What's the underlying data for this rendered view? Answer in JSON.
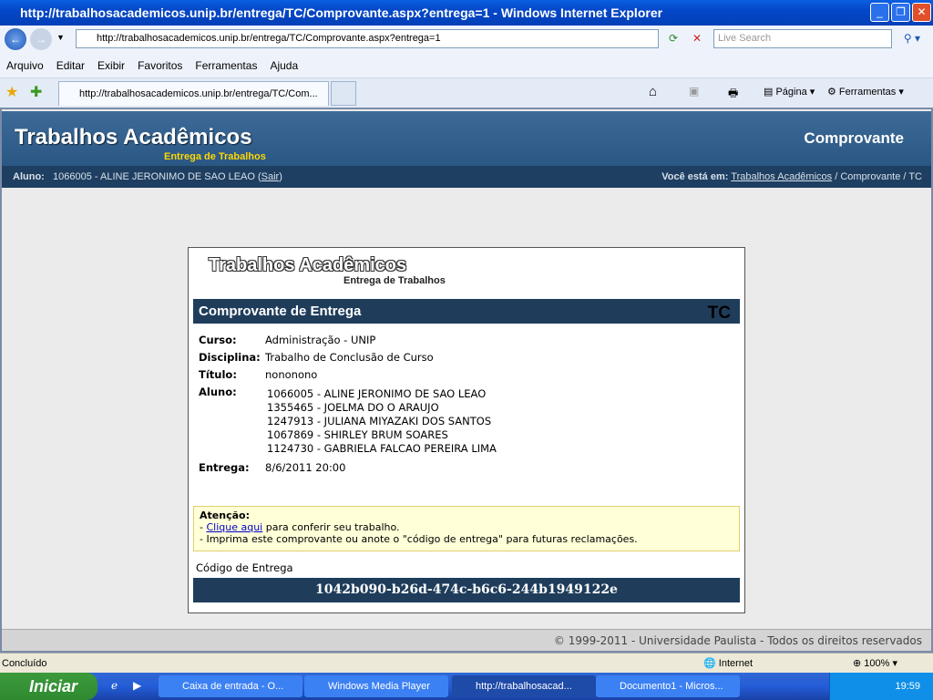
{
  "window": {
    "title": "http://trabalhosacademicos.unip.br/entrega/TC/Comprovante.aspx?entrega=1 - Windows Internet Explorer"
  },
  "browser": {
    "url": "http://trabalhosacademicos.unip.br/entrega/TC/Comprovante.aspx?entrega=1",
    "search_placeholder": "Live Search",
    "menu": [
      "Arquivo",
      "Editar",
      "Exibir",
      "Favoritos",
      "Ferramentas",
      "Ajuda"
    ],
    "tab": "http://trabalhosacademicos.unip.br/entrega/TC/Com...",
    "pagina": "Página",
    "ferramentas": "Ferramentas"
  },
  "header": {
    "title": "Trabalhos Acadêmicos",
    "subtitle": "Entrega de Trabalhos",
    "right": "Comprovante"
  },
  "subbar": {
    "aluno_label": "Aluno:",
    "aluno_value": "1066005 - ALINE JERONIMO DE SAO LEAO (",
    "sair": "Sair",
    "close_paren": ")",
    "location_label": "Você está em:",
    "crumb_link": "Trabalhos Acadêmicos",
    "crumb_rest": " / Comprovante / TC"
  },
  "receipt": {
    "logo_title": "Trabalhos Acadêmicos",
    "logo_sub": "Entrega de Trabalhos",
    "heading": "Comprovante de Entrega",
    "badge": "TC",
    "fields": {
      "curso_label": "Curso:",
      "curso": "Administração - UNIP",
      "disciplina_label": "Disciplina:",
      "disciplina": "Trabalho de Conclusão de Curso",
      "titulo_label": "Título:",
      "titulo": "nononono",
      "aluno_label": "Aluno:",
      "entrega_label": "Entrega:",
      "entrega": "8/6/2011 20:00"
    },
    "alunos": [
      "1066005 - ALINE JERONIMO DE SAO LEAO",
      "1355465 - JOELMA DO O ARAUJO",
      "1247913 - JULIANA MIYAZAKI DOS SANTOS",
      "1067869 - SHIRLEY BRUM SOARES",
      "1124730 - GABRIELA FALCAO PEREIRA LIMA"
    ],
    "attention": {
      "title": "Atenção:",
      "line1_prefix": "- ",
      "line1_link": "Clique aqui",
      "line1_rest": " para conferir seu trabalho.",
      "line2": "- Imprima este comprovante ou anote o \"código de entrega\" para futuras reclamações."
    },
    "code_label": "Código de Entrega",
    "code": "1042b090-b26d-474c-b6c6-244b1949122e"
  },
  "footer": "© 1999-2011 - Universidade Paulista - Todos os direitos reservados",
  "status": {
    "text": "Concluído",
    "zone": "Internet",
    "zoom": "100%"
  },
  "taskbar": {
    "start": "Iniciar",
    "tasks": [
      "Caixa de entrada - O...",
      "Windows Media Player",
      "http://trabalhosacad...",
      "Documento1 - Micros..."
    ],
    "clock": "19:59"
  }
}
